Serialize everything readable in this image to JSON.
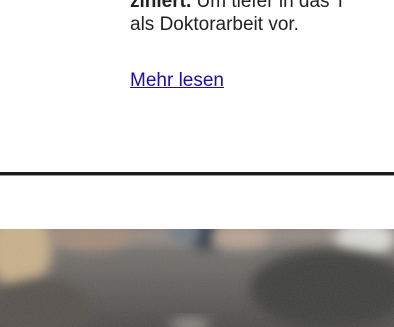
{
  "article": {
    "line1_bold": "ziniert.",
    "line1_rest": " Um tiefer in das T",
    "line2": "als Doktorarbeit vor.",
    "read_more": "Mehr lesen"
  }
}
